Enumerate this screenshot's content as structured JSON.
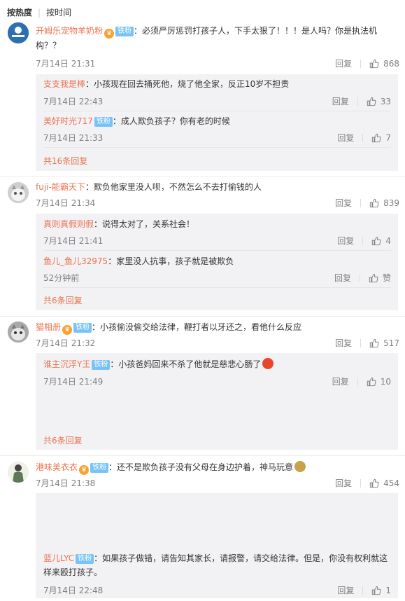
{
  "sort_bar": {
    "hot": "按热度",
    "time": "按时间"
  },
  "comments": [
    {
      "user": "开姆乐宠物羊奶粉",
      "fans_badge": "铁粉",
      "text": "：必须严厉惩罚打孩子人，下手太狠了！！！是人吗？你是执法机构？？",
      "text_line1": "：必须严厉惩罚打孩子人，下手太狠了！！！是人吗？你是执法机",
      "text_line2": "构？？",
      "time": "7月14日 21:31",
      "reply_label": "回复",
      "likes": "868",
      "avatar_text": "KERLEEK",
      "replies": [
        {
          "user": "支支我是棒",
          "text": "：小孩现在回去捅死他，烧了他全家，反正10岁不担责",
          "time": "7月14日 22:43",
          "likes": "33"
        },
        {
          "user": "美好时光717",
          "fans_badge": "铁粉",
          "text": "：成人欺负孩子？你有老的时候",
          "time": "7月14日 21:33",
          "likes": "7"
        }
      ],
      "more": "共16条回复"
    },
    {
      "user": "fuji-能霸天下",
      "text": "：欺负他家里没人呗，不然怎么不去打偷钱的人",
      "time": "7月14日 21:34",
      "reply_label": "回复",
      "likes": "839",
      "replies": [
        {
          "user": "真则真假则假",
          "text": "：说得太对了，关系社会！",
          "time": "7月14日 21:41",
          "likes": "4"
        },
        {
          "user": "鱼儿_鱼儿32975",
          "text": "：家里没人抗事，孩子就是被欺负",
          "time": "52分钟前",
          "likes": "赞"
        }
      ],
      "more": "共6条回复"
    },
    {
      "user": "猫相册",
      "fans_badge": "铁粉",
      "text": "：小孩偷没偷交给法律，鞭打者以牙还之，看他什么反应",
      "time": "7月14日 21:32",
      "reply_label": "回复",
      "likes": "517",
      "replies": [
        {
          "user": "谁主沉浮Y王",
          "fans_badge": "铁粉",
          "text": "：小孩爸妈回来不杀了他就是慈悲心肠了",
          "time": "7月14日 21:49",
          "likes": "10"
        }
      ],
      "more": "共6条回复"
    },
    {
      "user": "港味美衣衣",
      "fans_badge": "铁粉",
      "text": "：还不是欺负孩子没有父母在身边护着，神马玩意",
      "time": "7月14日 21:38",
      "reply_label": "回复",
      "likes": "454",
      "replies": [
        {
          "user": "蓝儿LYC",
          "fans_badge": "铁粉",
          "text": "：如果孩子做错，请告知其家长，请报警，请交给法律。但是，你没有权利就这样来殴打孩子。",
          "text_line1": "：如果孩子做错，请告知其家长，请报警，请交给法律。但是，你没有权利就这",
          "text_line2": "样来殴打孩子。",
          "time": "7月14日 22:48",
          "likes": "1"
        }
      ]
    }
  ],
  "colors": {
    "username": "#eb7350",
    "badge": "#77c3f7",
    "reply_bg": "#f2f2f5",
    "meta": "#808080"
  },
  "icons": {
    "like": "thumbs-up-icon",
    "vip": "vip-crown-icon"
  }
}
